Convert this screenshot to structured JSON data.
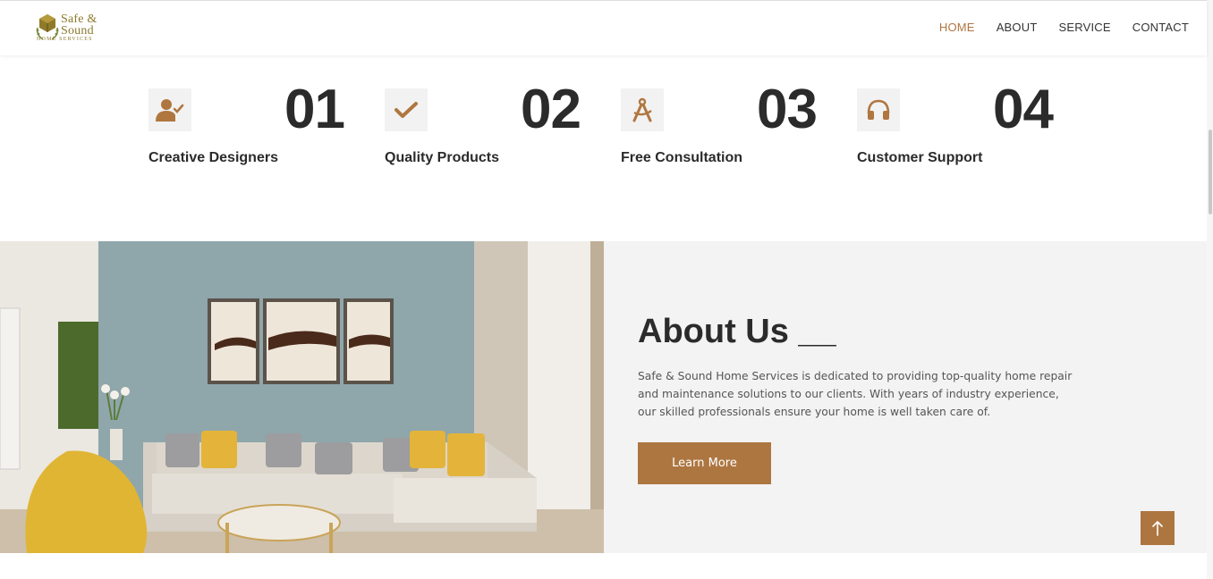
{
  "brand": {
    "name_line1": "Safe &",
    "name_line2": "Sound",
    "tagline": "HOME SERVICES",
    "color": "#8b7a2e"
  },
  "nav": {
    "items": [
      {
        "label": "HOME",
        "active": true
      },
      {
        "label": "ABOUT",
        "active": false
      },
      {
        "label": "SERVICE",
        "active": false
      },
      {
        "label": "CONTACT",
        "active": false
      }
    ],
    "active_color": "#b07640"
  },
  "features": [
    {
      "number": "01",
      "label": "Creative Designers",
      "icon": "user-check-icon"
    },
    {
      "number": "02",
      "label": "Quality Products",
      "icon": "check-icon"
    },
    {
      "number": "03",
      "label": "Free Consultation",
      "icon": "compass-icon"
    },
    {
      "number": "04",
      "label": "Customer Support",
      "icon": "headphones-icon"
    }
  ],
  "about": {
    "title": "About Us __",
    "text": "Safe & Sound Home Services is dedicated to providing top-quality home repair and maintenance solutions to our clients. With years of industry experience, our skilled professionals ensure your home is well taken care of.",
    "button_label": "Learn More",
    "image": "living-room-photo"
  },
  "colors": {
    "accent": "#ad7641",
    "icon_bg": "#f2f2f2",
    "panel_bg": "#f3f3f3"
  },
  "scroll_to_top": "arrow-up-icon"
}
